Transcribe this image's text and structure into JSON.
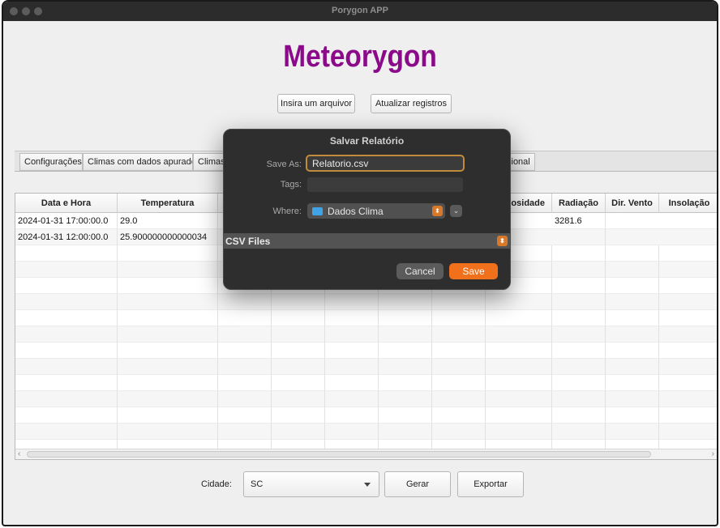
{
  "window": {
    "title": "Porygon APP"
  },
  "app": {
    "heading": "Meteorygon"
  },
  "toolbar": {
    "insert_label": "Insira um arquivor",
    "refresh_label": "Atualizar registros"
  },
  "tabs": [
    {
      "label": "Configurações"
    },
    {
      "label": "Climas com dados apurados"
    },
    {
      "label": "Climas"
    },
    {
      "label": "cional"
    }
  ],
  "table": {
    "columns": [
      "Data e Hora",
      "Temperatura",
      "",
      "",
      "",
      "",
      "",
      "ulosidade",
      "Radiação",
      "Dir. Vento",
      "Insolação"
    ],
    "rows": [
      {
        "datetime": "2024-01-31 17:00:00.0",
        "temperature": "29.0",
        "radiation": "3281.6"
      },
      {
        "datetime": "2024-01-31 12:00:00.0",
        "temperature": "25.900000000000034",
        "radiation": ""
      }
    ]
  },
  "bottom": {
    "city_label": "Cidade:",
    "city_value": "SC",
    "generate_label": "Gerar",
    "export_label": "Exportar"
  },
  "dialog": {
    "title": "Salvar Relatório",
    "save_as_label": "Save As:",
    "save_as_value": "Relatorio.csv",
    "tags_label": "Tags:",
    "where_label": "Where:",
    "where_value": "Dados Clima",
    "file_type": "CSV Files",
    "cancel_label": "Cancel",
    "save_label": "Save",
    "accent_color": "#f0701c"
  }
}
